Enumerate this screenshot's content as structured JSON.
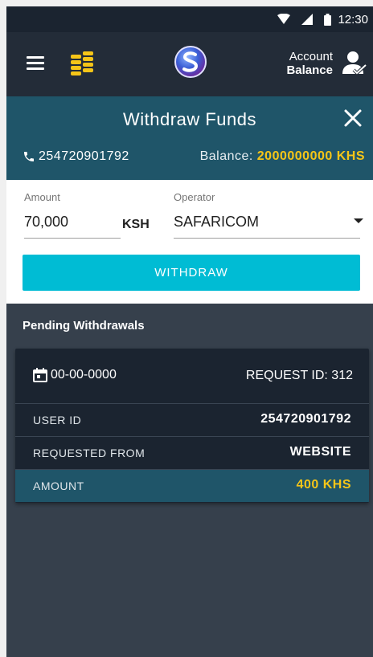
{
  "status": {
    "time": "12:30"
  },
  "appbar": {
    "account_line1": "Account",
    "account_line2": "Balance"
  },
  "withdraw": {
    "title": "Withdraw Funds",
    "phone": "254720901792",
    "balance_label": "Balance:",
    "balance_value": "2000000000 KHS"
  },
  "form": {
    "amount_label": "Amount",
    "amount_value": "70,000",
    "currency": "KSH",
    "operator_label": "Operator",
    "operator_value": "SAFARICOM",
    "submit_label": "WITHDRAW"
  },
  "pending": {
    "title": "Pending Withdrawals",
    "card": {
      "date": "00-00-0000",
      "request_id": "REQUEST ID: 312",
      "user_id_label": "USER ID",
      "user_id_value": "254720901792",
      "requested_from_label": "REQUESTED FROM",
      "requested_from_value": "WEBSITE",
      "amount_label": "AMOUNT",
      "amount_value": "400 KHS"
    }
  },
  "colors": {
    "accent": "#00bcd4",
    "header_teal": "#1f5569",
    "gold": "#f5c518",
    "dark": "#1b2430"
  }
}
